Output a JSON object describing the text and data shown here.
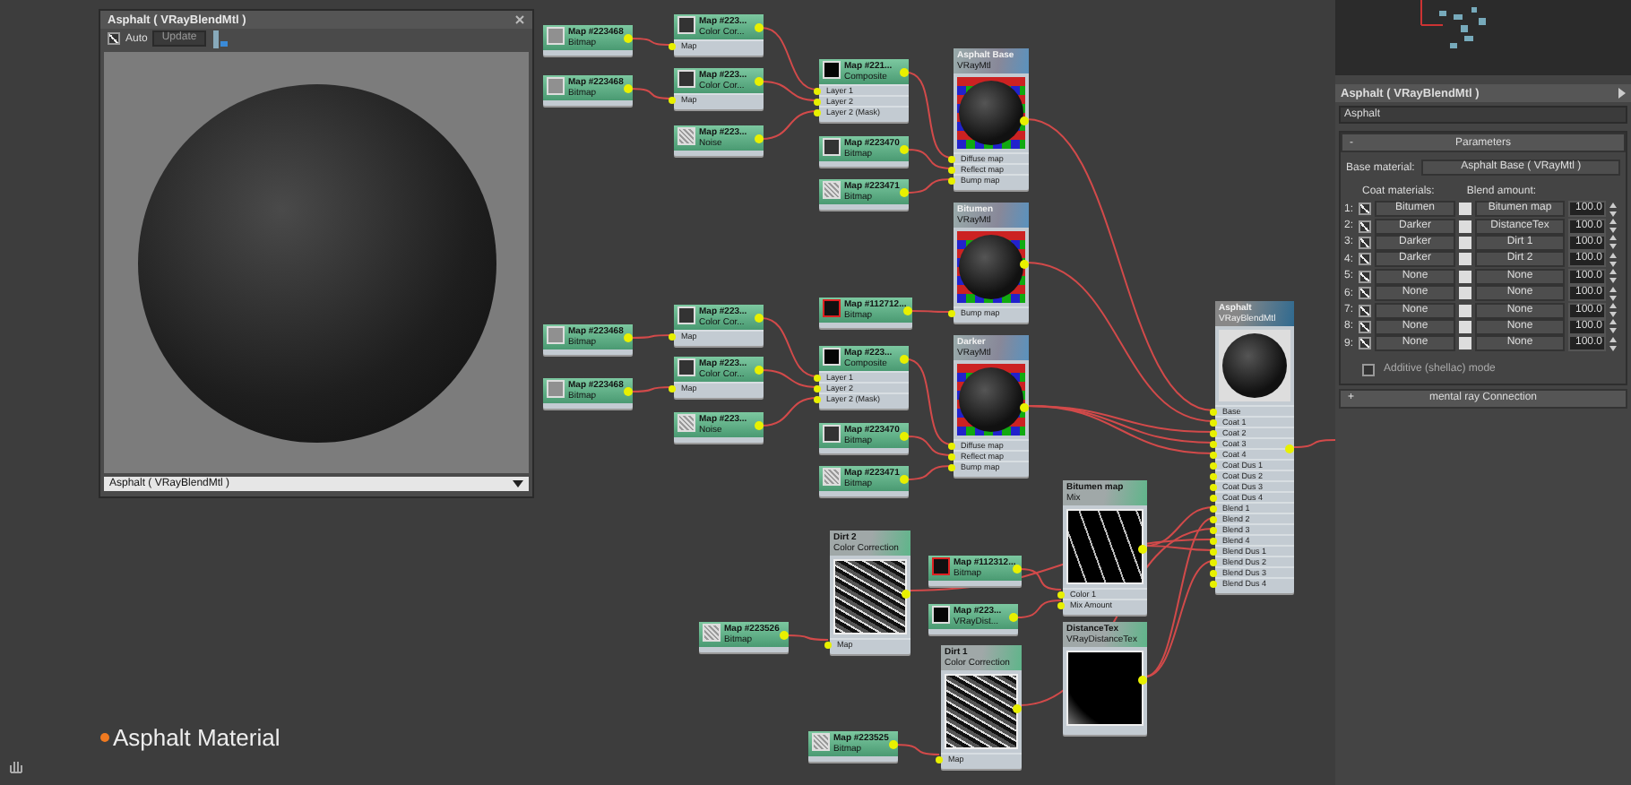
{
  "preview_window": {
    "title": "Asphalt  ( VRayBlendMtl )",
    "auto": {
      "label": "Auto",
      "checked": true
    },
    "update_button": "Update",
    "material_dropdown": "Asphalt  ( VRayBlendMtl )"
  },
  "nodes": [
    {
      "kind": "map",
      "title": "Map #223468",
      "subtitle": "Bitmap"
    },
    {
      "kind": "map",
      "title": "Map #223468",
      "subtitle": "Bitmap"
    },
    {
      "kind": "map",
      "title": "Map #223...",
      "subtitle": "Color Cor...",
      "slots": [
        "Map"
      ]
    },
    {
      "kind": "map",
      "title": "Map #223...",
      "subtitle": "Color Cor...",
      "slots": [
        "Map"
      ]
    },
    {
      "kind": "map",
      "title": "Map #223...",
      "subtitle": "Noise"
    },
    {
      "kind": "map",
      "title": "Map #221...",
      "subtitle": "Composite",
      "slots": [
        "Layer 1",
        "Layer 2",
        "Layer 2 (Mask)"
      ]
    },
    {
      "kind": "map",
      "title": "Map #223470",
      "subtitle": "Bitmap"
    },
    {
      "kind": "map",
      "title": "Map #223471",
      "subtitle": "Bitmap"
    },
    {
      "kind": "map",
      "title": "Map #112712...",
      "subtitle": "Bitmap"
    },
    {
      "kind": "material",
      "title": "Asphalt Base",
      "subtitle": "VRayMtl",
      "slots": [
        "Diffuse map",
        "Reflect map",
        "Bump map"
      ]
    },
    {
      "kind": "material",
      "title": "Bitumen",
      "subtitle": "VRayMtl",
      "slots": [
        "Bump map"
      ]
    },
    {
      "kind": "map",
      "title": "Map #223468",
      "subtitle": "Bitmap"
    },
    {
      "kind": "map",
      "title": "Map #223468",
      "subtitle": "Bitmap"
    },
    {
      "kind": "map",
      "title": "Map #223...",
      "subtitle": "Color Cor...",
      "slots": [
        "Map"
      ]
    },
    {
      "kind": "map",
      "title": "Map #223...",
      "subtitle": "Color Cor...",
      "slots": [
        "Map"
      ]
    },
    {
      "kind": "map",
      "title": "Map #223...",
      "subtitle": "Noise"
    },
    {
      "kind": "map",
      "title": "Map #223...",
      "subtitle": "Composite",
      "slots": [
        "Layer 1",
        "Layer 2",
        "Layer 2 (Mask)"
      ]
    },
    {
      "kind": "map",
      "title": "Map #223470",
      "subtitle": "Bitmap"
    },
    {
      "kind": "map",
      "title": "Map #223471",
      "subtitle": "Bitmap"
    },
    {
      "kind": "material",
      "title": "Darker",
      "subtitle": "VRayMtl",
      "slots": [
        "Diffuse map",
        "Reflect map",
        "Bump map"
      ]
    },
    {
      "kind": "map-preview",
      "title": "Dirt 2",
      "subtitle": "Color Correction",
      "slots": [
        "Map"
      ]
    },
    {
      "kind": "map",
      "title": "Map #223526",
      "subtitle": "Bitmap"
    },
    {
      "kind": "map",
      "title": "Map #112312...",
      "subtitle": "Bitmap"
    },
    {
      "kind": "map",
      "title": "Map #223...",
      "subtitle": "VRayDist..."
    },
    {
      "kind": "map-preview",
      "title": "Bitumen map",
      "subtitle": "Mix",
      "slots": [
        "Color 1",
        "Mix Amount"
      ]
    },
    {
      "kind": "map-preview",
      "title": "Dirt 1",
      "subtitle": "Color Correction",
      "slots": [
        "Map"
      ]
    },
    {
      "kind": "map",
      "title": "Map #223525",
      "subtitle": "Bitmap"
    },
    {
      "kind": "map-preview",
      "title": "DistanceTex",
      "subtitle": "VRayDistanceTex"
    },
    {
      "kind": "blend",
      "title": "Asphalt",
      "subtitle": "VRayBlendMtl",
      "slots": [
        "Base",
        "Coat 1",
        "Coat 2",
        "Coat 3",
        "Coat 4",
        "Coat Dus 1",
        "Coat Dus 2",
        "Coat Dus 3",
        "Coat Dus 4",
        "Blend 1",
        "Blend 2",
        "Blend 3",
        "Blend 4",
        "Blend Dus 1",
        "Blend Dus 2",
        "Blend Dus 3",
        "Blend Dus 4"
      ]
    }
  ],
  "canvas_label": "Asphalt Material",
  "panel": {
    "title": "Asphalt  ( VRayBlendMtl )",
    "name": "Asphalt",
    "rollout": {
      "toggle": "-",
      "title": "Parameters"
    },
    "base_label": "Base material:",
    "base_value": "Asphalt Base  ( VRayMtl )",
    "coat_header": "Coat materials:",
    "blend_header": "Blend amount:",
    "rows": [
      {
        "index": "1:",
        "checked": true,
        "coat": "Bitumen",
        "blend": "Bitumen map",
        "amount": "100.0"
      },
      {
        "index": "2:",
        "checked": true,
        "coat": "Darker",
        "blend": "DistanceTex",
        "amount": "100.0"
      },
      {
        "index": "3:",
        "checked": true,
        "coat": "Darker",
        "blend": "Dirt 1",
        "amount": "100.0"
      },
      {
        "index": "4:",
        "checked": true,
        "coat": "Darker",
        "blend": "Dirt 2",
        "amount": "100.0"
      },
      {
        "index": "5:",
        "checked": true,
        "coat": "None",
        "blend": "None",
        "amount": "100.0"
      },
      {
        "index": "6:",
        "checked": true,
        "coat": "None",
        "blend": "None",
        "amount": "100.0"
      },
      {
        "index": "7:",
        "checked": true,
        "coat": "None",
        "blend": "None",
        "amount": "100.0"
      },
      {
        "index": "8:",
        "checked": true,
        "coat": "None",
        "blend": "None",
        "amount": "100.0"
      },
      {
        "index": "9:",
        "checked": true,
        "coat": "None",
        "blend": "None",
        "amount": "100.0"
      }
    ],
    "additive": {
      "label": "Additive (shellac) mode",
      "checked": false
    },
    "mental_ray": {
      "toggle": "+",
      "label": "mental ray Connection"
    }
  }
}
